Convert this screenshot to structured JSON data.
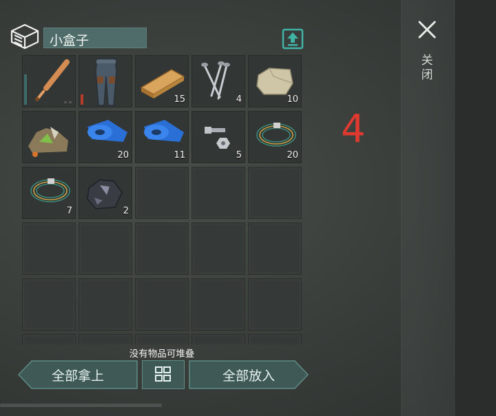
{
  "container": {
    "title": "小盒子",
    "upload_icon": "upload-icon",
    "box_icon": "box-icon"
  },
  "close": {
    "label": "关闭",
    "icon": "close-icon"
  },
  "slots": [
    {
      "item": "baseball-bat",
      "count": "",
      "durability": 0.6
    },
    {
      "item": "armored-pants",
      "count": "",
      "durability": 0.2
    },
    {
      "item": "wood-plank",
      "count": "15"
    },
    {
      "item": "nails",
      "count": "4"
    },
    {
      "item": "stone",
      "count": "10"
    },
    {
      "item": "scrap-pile",
      "count": ""
    },
    {
      "item": "duct-tape",
      "count": "20"
    },
    {
      "item": "duct-tape",
      "count": "11"
    },
    {
      "item": "nuts-and-bolts",
      "count": "5"
    },
    {
      "item": "wire-coil",
      "count": "20"
    },
    {
      "item": "wire-coil",
      "count": "7"
    },
    {
      "item": "iron-ore",
      "count": "2"
    }
  ],
  "stack_message": "没有物品可堆叠",
  "buttons": {
    "take_all": "全部拿上",
    "sort_icon": "sort-icon",
    "put_all": "全部放入"
  },
  "annotation_number": "4",
  "colors": {
    "accent": "#4f6c6a",
    "button": "#3f5956",
    "annotation": "#e0392f"
  }
}
